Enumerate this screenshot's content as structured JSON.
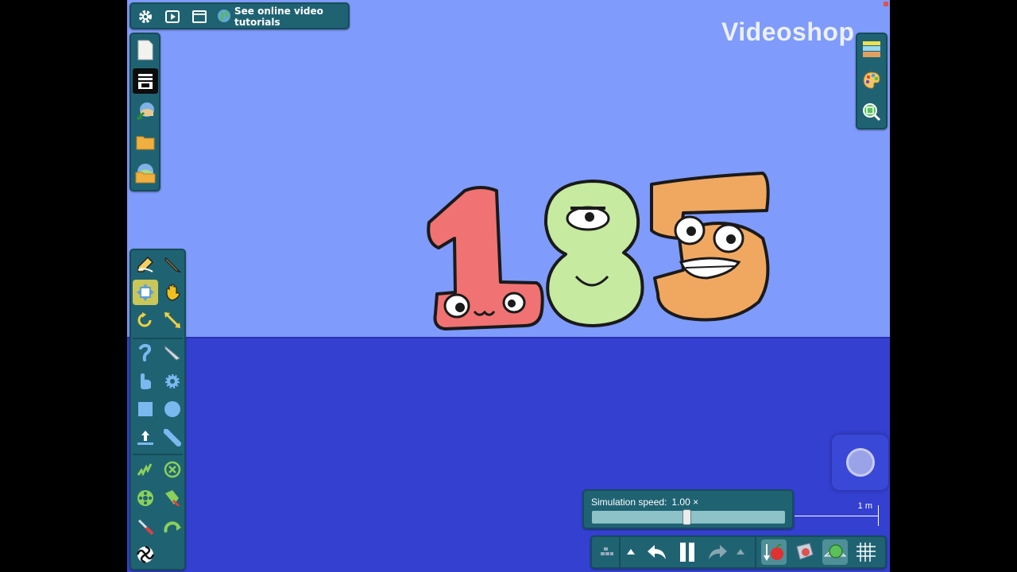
{
  "app": {
    "watermark": "Videoshop"
  },
  "topbar": {
    "tutorial_label": "See online video tutorials",
    "icons": [
      "gear-icon",
      "play-icon",
      "window-icon",
      "globe-icon"
    ]
  },
  "filebar": {
    "icons": [
      "new-file-icon",
      "library-icon",
      "open-scene-icon",
      "folder-icon",
      "save-icon"
    ]
  },
  "toolbar": {
    "selected": "move-tool",
    "tools": [
      "sketch-tool",
      "pencil-tool",
      "move-tool",
      "grab-tool",
      "rotate-tool",
      "scale-tool",
      "chain-tool",
      "knife-tool",
      "brush-tool",
      "gear-tool",
      "box-tool",
      "circle-tool",
      "plane-tool",
      "chain-links-tool",
      "spring-tool",
      "fixate-tool",
      "axle-tool",
      "thruster-tool",
      "laser-tool",
      "hinge-tool",
      "tracer-tool"
    ]
  },
  "rightbar": {
    "icons": [
      "background-icon",
      "palette-icon",
      "zoom-icon"
    ]
  },
  "scene": {
    "numbers": [
      "1",
      "8",
      "5"
    ],
    "colors": {
      "sky": "#7f9bfb",
      "ground": "#3440d0",
      "one": "#f07272",
      "eight": "#c6eaa0",
      "five": "#f0a860"
    }
  },
  "simulation": {
    "label": "Simulation speed:",
    "value": "1.00 ×",
    "slider_position": 0.49
  },
  "scale": {
    "label": "1 m"
  },
  "bottombar": {
    "icons": [
      "grid-snap-icon",
      "up-arrow-icon",
      "undo-icon",
      "pause-icon",
      "redo-icon",
      "up-arrow-icon",
      "gravity-icon",
      "air-friction-icon",
      "collision-icon",
      "grid-icon"
    ]
  }
}
